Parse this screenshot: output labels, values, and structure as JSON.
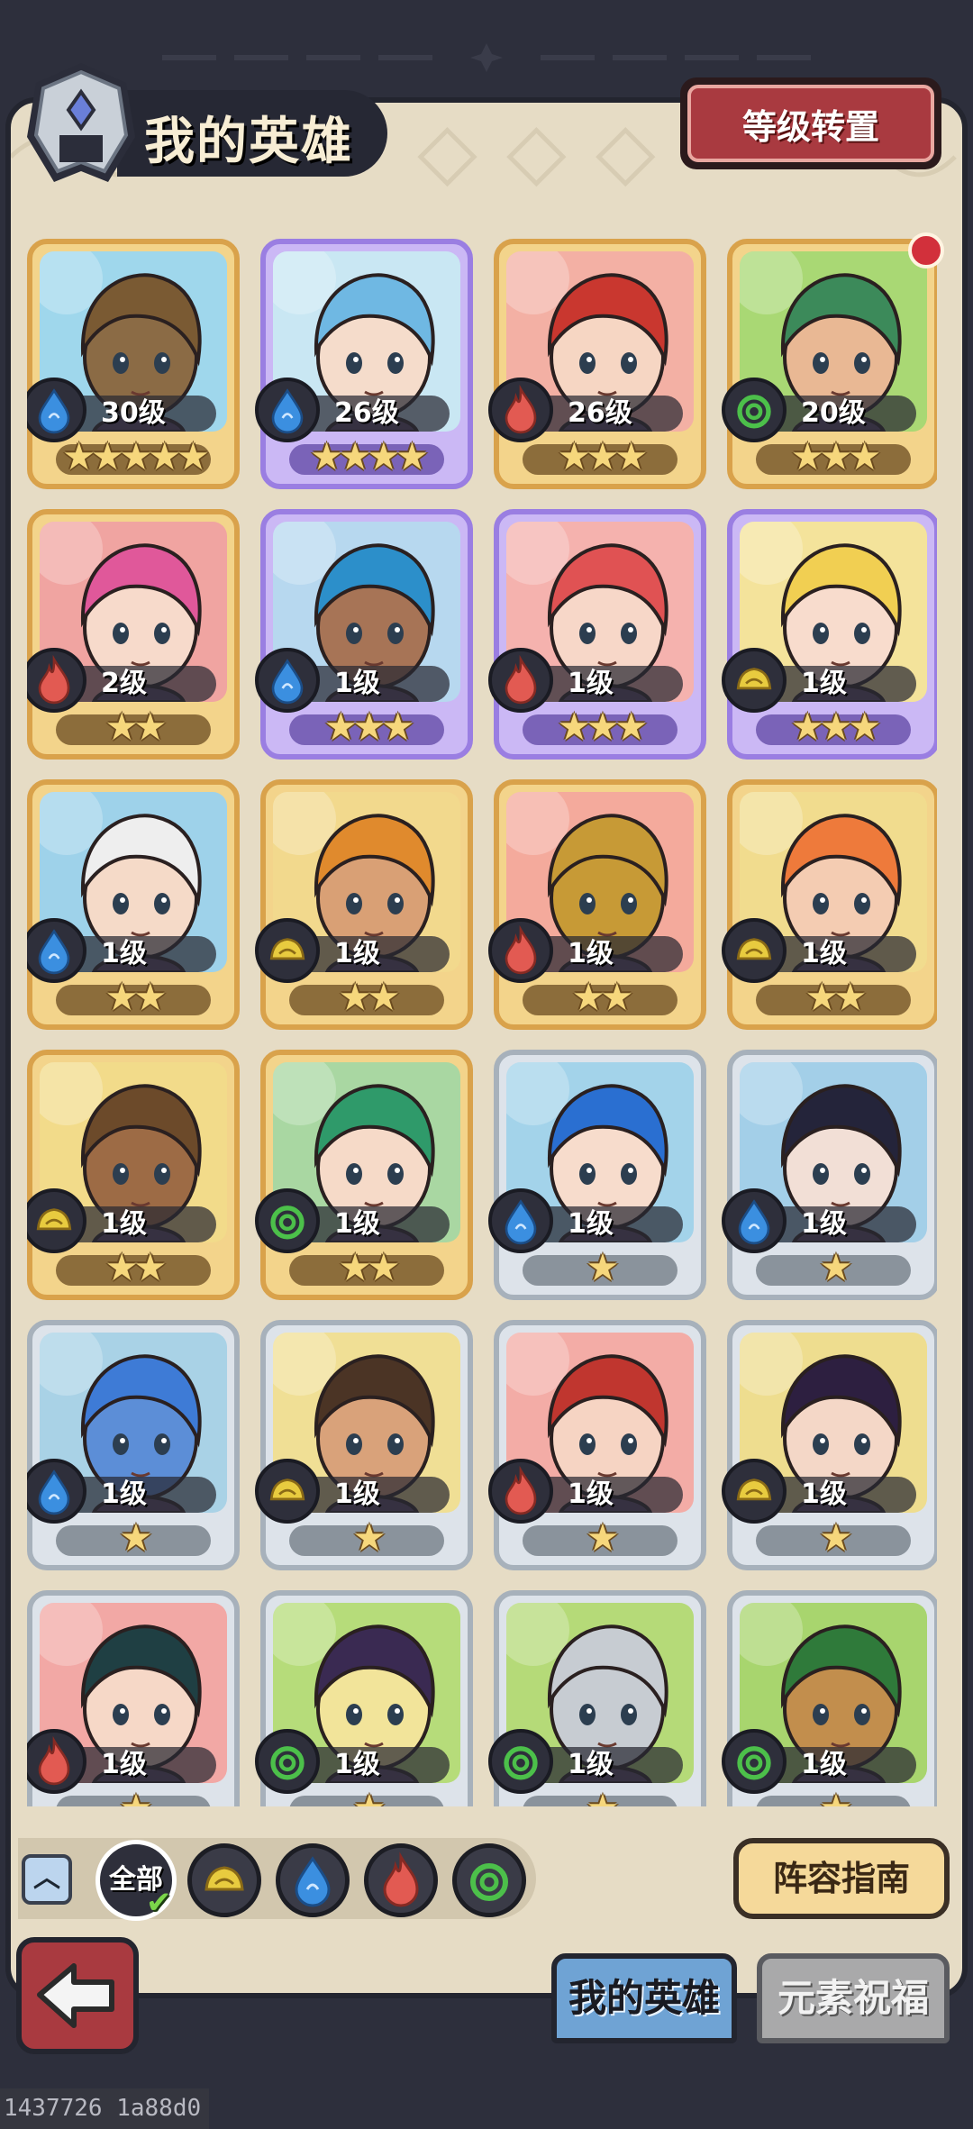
{
  "header": {
    "title": "我的英雄",
    "level_reset_label": "等级转置"
  },
  "heroes": [
    {
      "level": "30级",
      "stars": 5,
      "element": "water",
      "frame": "gold",
      "bg": "#9fd7ec",
      "hair": "#7a5a33",
      "skin": "#8b6b45"
    },
    {
      "level": "26级",
      "stars": 4,
      "element": "water",
      "frame": "purple",
      "bg": "#c9e7f3",
      "hair": "#6fb8e3",
      "skin": "#f5dccb"
    },
    {
      "level": "26级",
      "stars": 3,
      "element": "fire",
      "frame": "gold",
      "bg": "#f3b0a4",
      "hair": "#c9372f",
      "skin": "#f6d6c3"
    },
    {
      "level": "20级",
      "stars": 3,
      "element": "wind",
      "frame": "gold",
      "bg": "#a9d874",
      "hair": "#3c8a5a",
      "skin": "#e9b894"
    },
    {
      "level": "2级",
      "stars": 2,
      "element": "fire",
      "frame": "gold",
      "bg": "#f0a4a1",
      "hair": "#e0589a",
      "skin": "#f7dacb"
    },
    {
      "level": "1级",
      "stars": 3,
      "element": "water",
      "frame": "purple",
      "bg": "#b7d8ef",
      "hair": "#2c8fca",
      "skin": "#a77456"
    },
    {
      "level": "1级",
      "stars": 3,
      "element": "fire",
      "frame": "purple",
      "bg": "#f5b2ae",
      "hair": "#e05253",
      "skin": "#f7d7c8"
    },
    {
      "level": "1级",
      "stars": 3,
      "element": "earth",
      "frame": "purple",
      "bg": "#f4e39b",
      "hair": "#f1cf52",
      "skin": "#f8dccd"
    },
    {
      "level": "1级",
      "stars": 2,
      "element": "water",
      "frame": "gold",
      "bg": "#9ed2ea",
      "hair": "#eeeeee",
      "skin": "#f5dac8"
    },
    {
      "level": "1级",
      "stars": 2,
      "element": "earth",
      "frame": "gold",
      "bg": "#f2d98d",
      "hair": "#e08a2d",
      "skin": "#d9a075"
    },
    {
      "level": "1级",
      "stars": 2,
      "element": "fire",
      "frame": "gold",
      "bg": "#f4aa9c",
      "hair": "#c79a36",
      "skin": "#c79a36"
    },
    {
      "level": "1级",
      "stars": 2,
      "element": "earth",
      "frame": "gold",
      "bg": "#f1dc8e",
      "hair": "#ee7a3b",
      "skin": "#f4ccb2"
    },
    {
      "level": "1级",
      "stars": 2,
      "element": "earth",
      "frame": "gold",
      "bg": "#f2db8a",
      "hair": "#6c4a2a",
      "skin": "#9d6b45"
    },
    {
      "level": "1级",
      "stars": 2,
      "element": "wind",
      "frame": "gold",
      "bg": "#a9d7a2",
      "hair": "#2f9a6a",
      "skin": "#f6dac8"
    },
    {
      "level": "1级",
      "stars": 1,
      "element": "water",
      "frame": "silver",
      "bg": "#a3d3ea",
      "hair": "#2a6fd1",
      "skin": "#f7dccc"
    },
    {
      "level": "1级",
      "stars": 1,
      "element": "water",
      "frame": "silver",
      "bg": "#a3cfe8",
      "hair": "#24243a",
      "skin": "#f2dfd6"
    },
    {
      "level": "1级",
      "stars": 1,
      "element": "water",
      "frame": "silver",
      "bg": "#a9d2e6",
      "hair": "#3e7bd6",
      "skin": "#5c8ed7"
    },
    {
      "level": "1级",
      "stars": 1,
      "element": "earth",
      "frame": "silver",
      "bg": "#f0df95",
      "hair": "#4b3425",
      "skin": "#d9a27a"
    },
    {
      "level": "1级",
      "stars": 1,
      "element": "fire",
      "frame": "silver",
      "bg": "#f3aca6",
      "hair": "#c0362f",
      "skin": "#f6d4c3"
    },
    {
      "level": "1级",
      "stars": 1,
      "element": "earth",
      "frame": "silver",
      "bg": "#eedd8f",
      "hair": "#2d1f40",
      "skin": "#f4d7c7"
    },
    {
      "level": "1级",
      "stars": 1,
      "element": "fire",
      "frame": "silver",
      "bg": "#f2a8a5",
      "hair": "#1f3f43",
      "skin": "#f6d8c7"
    },
    {
      "level": "1级",
      "stars": 1,
      "element": "wind",
      "frame": "silver",
      "bg": "#b6dc7a",
      "hair": "#3a2a52",
      "skin": "#f2e49a"
    },
    {
      "level": "1级",
      "stars": 1,
      "element": "wind",
      "frame": "silver",
      "bg": "#b5da78",
      "hair": "#c7ccd2",
      "skin": "#c7ccd2"
    },
    {
      "level": "1级",
      "stars": 1,
      "element": "wind",
      "frame": "silver",
      "bg": "#a8d56e",
      "hair": "#2f7a3a",
      "skin": "#c28e4d"
    }
  ],
  "filters": {
    "all_label": "全部",
    "elements": [
      "earth",
      "water",
      "fire",
      "wind"
    ]
  },
  "guide_label": "阵容指南",
  "tabs": {
    "my_heroes": "我的英雄",
    "element_blessing": "元素祝福"
  },
  "footer_id": "1437726 1a88d0",
  "colors": {
    "water": "#3b8fe0",
    "fire": "#e25a52",
    "wind": "#4cc04a",
    "earth": "#e8cb3f"
  }
}
